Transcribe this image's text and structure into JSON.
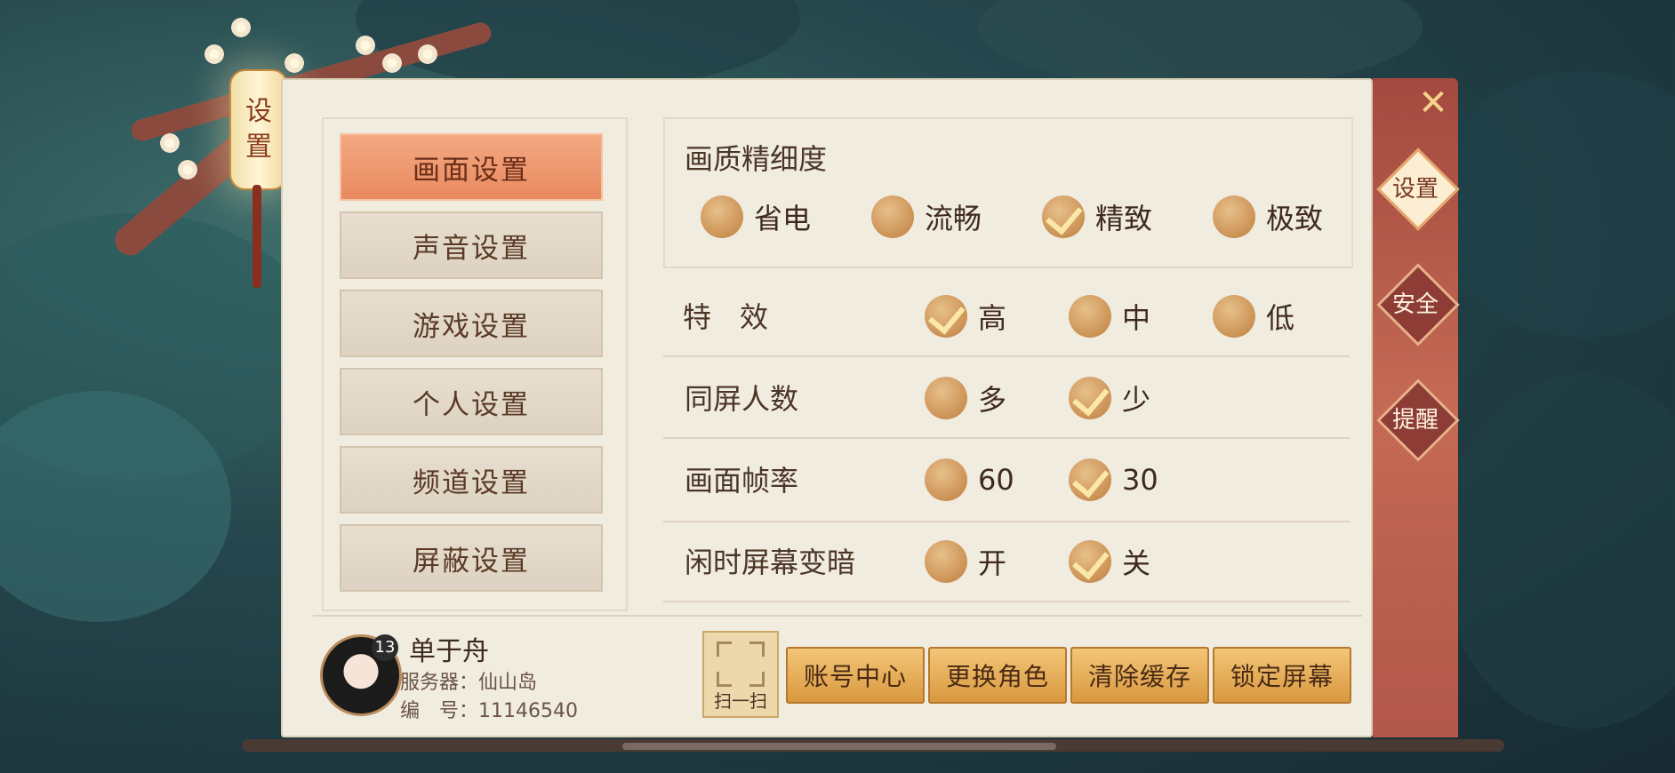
{
  "lantern": {
    "line1": "设",
    "line2": "置"
  },
  "menu": {
    "items": [
      {
        "label": "画面设置",
        "active": true
      },
      {
        "label": "声音设置",
        "active": false
      },
      {
        "label": "游戏设置",
        "active": false
      },
      {
        "label": "个人设置",
        "active": false
      },
      {
        "label": "频道设置",
        "active": false
      },
      {
        "label": "屏蔽设置",
        "active": false
      }
    ]
  },
  "side_tabs": [
    {
      "label": "设置",
      "active": true
    },
    {
      "label": "安全",
      "active": false
    },
    {
      "label": "提醒",
      "active": false
    }
  ],
  "settings": {
    "quality": {
      "label": "画质精细度",
      "options": [
        {
          "label": "省电",
          "checked": false
        },
        {
          "label": "流畅",
          "checked": false
        },
        {
          "label": "精致",
          "checked": true
        },
        {
          "label": "极致",
          "checked": false
        }
      ]
    },
    "effects": {
      "label": "特　效",
      "options": [
        {
          "label": "高",
          "checked": true
        },
        {
          "label": "中",
          "checked": false
        },
        {
          "label": "低",
          "checked": false
        }
      ]
    },
    "players_on_screen": {
      "label": "同屏人数",
      "options": [
        {
          "label": "多",
          "checked": false
        },
        {
          "label": "少",
          "checked": true
        }
      ]
    },
    "frame_rate": {
      "label": "画面帧率",
      "options": [
        {
          "label": "60",
          "checked": false
        },
        {
          "label": "30",
          "checked": true
        }
      ]
    },
    "idle_dim": {
      "label": "闲时屏幕变暗",
      "options": [
        {
          "label": "开",
          "checked": false
        },
        {
          "label": "关",
          "checked": true
        }
      ]
    }
  },
  "player": {
    "level": "13",
    "name": "单于舟",
    "server_line": "服务器：仙山岛",
    "id_line": "编　号：11146540"
  },
  "qr": {
    "label": "扫一扫"
  },
  "buttons": {
    "account": "账号中心",
    "switch_role": "更换角色",
    "clear_cache": "清除缓存",
    "lock_screen": "锁定屏幕"
  },
  "close_icon": "close-icon",
  "colors": {
    "panel_bg": "#f1ece0",
    "active_menu": "#e9895f",
    "side_bar": "#b2574a",
    "button_gold": "#d9983f"
  }
}
